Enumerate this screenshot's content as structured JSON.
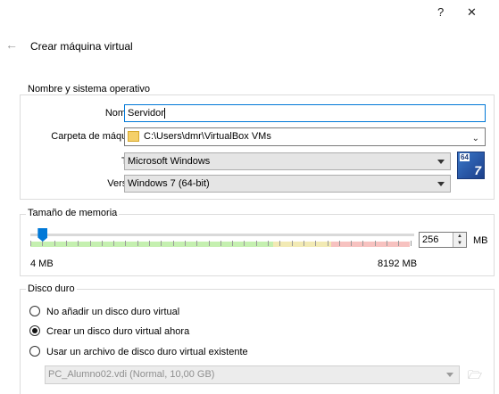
{
  "window": {
    "help_glyph": "?",
    "close_glyph": "✕",
    "title": "Crear máquina virtual"
  },
  "name_os": {
    "legend": "Nombre y sistema operativo",
    "name_label": "Nombre:",
    "name_value": "Servidor",
    "folder_label": "Carpeta de máquina:",
    "folder_value": "C:\\Users\\dmr\\VirtualBox VMs",
    "type_label": "Tipo:",
    "type_value": "Microsoft Windows",
    "version_label": "Versión:",
    "version_value": "Windows 7 (64-bit)",
    "os_icon_badge": "64",
    "os_icon_number": "7"
  },
  "memory": {
    "legend": "Tamaño de memoria",
    "value": "256",
    "unit": "MB",
    "min_label": "4 MB",
    "max_label": "8192 MB",
    "slider_level": 0.031
  },
  "disk": {
    "legend": "Disco duro",
    "options": [
      {
        "label": "No añadir un disco duro virtual",
        "selected": false
      },
      {
        "label": "Crear un disco duro virtual ahora",
        "selected": true
      },
      {
        "label": "Usar un archivo de disco duro virtual existente",
        "selected": false
      }
    ],
    "existing_file": "PC_Alumno02.vdi (Normal, 10,00 GB)"
  }
}
